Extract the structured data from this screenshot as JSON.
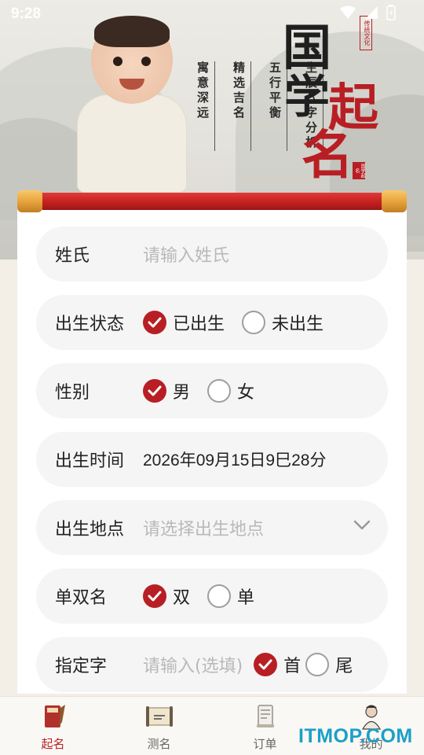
{
  "status_bar": {
    "time": "9:28"
  },
  "banner": {
    "title_chars": [
      "国",
      "学",
      "起",
      "名"
    ],
    "small_badge": "传统文化",
    "seal_text": "国学起名",
    "taglines": [
      "寓意深远",
      "精选吉名",
      "五行平衡",
      "生辰八字分析"
    ]
  },
  "form": {
    "surname": {
      "label": "姓氏",
      "placeholder": "请输入姓氏"
    },
    "birth_status": {
      "label": "出生状态",
      "options": [
        "已出生",
        "未出生"
      ],
      "selected": "已出生"
    },
    "gender": {
      "label": "性别",
      "options": [
        "男",
        "女"
      ],
      "selected": "男"
    },
    "birth_time": {
      "label": "出生时间",
      "value": "2026年09月15日9巳28分"
    },
    "birth_place": {
      "label": "出生地点",
      "placeholder": "请选择出生地点"
    },
    "name_length": {
      "label": "单双名",
      "options": [
        "双",
        "单"
      ],
      "selected": "双"
    },
    "specified_char": {
      "label": "指定字",
      "placeholder": "请输入(选填)",
      "options": [
        "首",
        "尾"
      ],
      "selected": "首"
    }
  },
  "nav": {
    "items": [
      {
        "label": "起名",
        "icon": "book-icon",
        "active": true
      },
      {
        "label": "测名",
        "icon": "scroll-icon",
        "active": false
      },
      {
        "label": "订单",
        "icon": "document-icon",
        "active": false
      },
      {
        "label": "我的",
        "icon": "scholar-icon",
        "active": false
      }
    ]
  },
  "watermark": "ITMOP.COM",
  "colors": {
    "accent": "#b81f24",
    "row_bg": "#f5f5f5",
    "placeholder": "#b9b9b9"
  }
}
